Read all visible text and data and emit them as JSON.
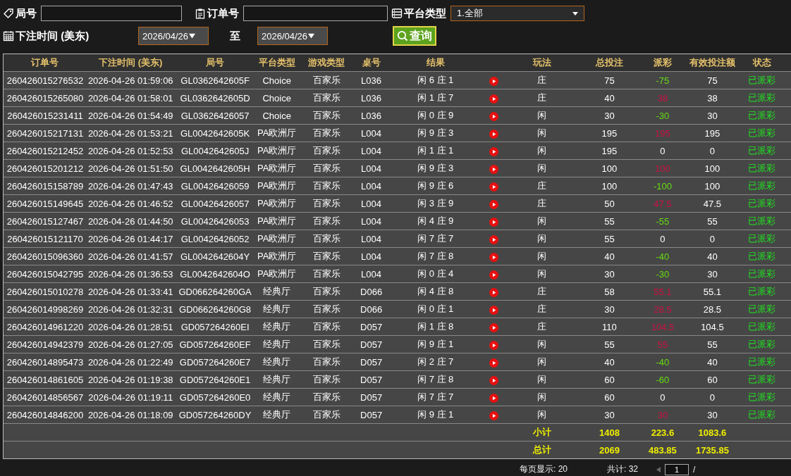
{
  "filters": {
    "round_label": "局号",
    "order_label": "订单号",
    "platform_label": "平台类型",
    "platform_value": "1.全部",
    "time_label": "下注时间 (美东)",
    "date_from": "2026/04/26",
    "to_label": "至",
    "date_to": "2026/04/26",
    "query_button": "查询"
  },
  "table": {
    "columns": [
      "订单号",
      "下注时间 (美东)",
      "局号",
      "平台类型",
      "游戏类型",
      "桌号",
      "结果",
      null,
      "玩法",
      "总投注",
      "派彩",
      "有效投注额",
      "状态"
    ],
    "rows": [
      {
        "order": "260426015276532",
        "time": "2026-04-26 01:59:06",
        "round": "GL0362642605F",
        "platform": "Choice",
        "game": "百家乐",
        "table": "L036",
        "result": "闲 6 庄 1",
        "bet": "庄",
        "total": "75",
        "payout": {
          "text": "-75",
          "color": "#66dd11"
        },
        "valid": "75",
        "status": "已派彩"
      },
      {
        "order": "260426015265080",
        "time": "2026-04-26 01:58:01",
        "round": "GL0362642605D",
        "platform": "Choice",
        "game": "百家乐",
        "table": "L036",
        "result": "闲 1 庄 7",
        "bet": "庄",
        "total": "40",
        "payout": {
          "text": "38",
          "color": "#cc1144"
        },
        "valid": "38",
        "status": "已派彩"
      },
      {
        "order": "260426015231411",
        "time": "2026-04-26 01:54:49",
        "round": "GL03626426057",
        "platform": "Choice",
        "game": "百家乐",
        "table": "L036",
        "result": "闲 0 庄 9",
        "bet": "闲",
        "total": "30",
        "payout": {
          "text": "-30",
          "color": "#66dd11"
        },
        "valid": "30",
        "status": "已派彩"
      },
      {
        "order": "260426015217131",
        "time": "2026-04-26 01:53:21",
        "round": "GL0042642605K",
        "platform": "PA欧洲厅",
        "game": "百家乐",
        "table": "L004",
        "result": "闲 9 庄 3",
        "bet": "闲",
        "total": "195",
        "payout": {
          "text": "195",
          "color": "#cc1144"
        },
        "valid": "195",
        "status": "已派彩"
      },
      {
        "order": "260426015212452",
        "time": "2026-04-26 01:52:53",
        "round": "GL0042642605J",
        "platform": "PA欧洲厅",
        "game": "百家乐",
        "table": "L004",
        "result": "闲 1 庄 1",
        "bet": "闲",
        "total": "195",
        "payout": {
          "text": "0",
          "color": "#ffffff"
        },
        "valid": "0",
        "status": "已派彩"
      },
      {
        "order": "260426015201212",
        "time": "2026-04-26 01:51:50",
        "round": "GL0042642605H",
        "platform": "PA欧洲厅",
        "game": "百家乐",
        "table": "L004",
        "result": "闲 9 庄 3",
        "bet": "闲",
        "total": "100",
        "payout": {
          "text": "100",
          "color": "#cc1144"
        },
        "valid": "100",
        "status": "已派彩"
      },
      {
        "order": "260426015158789",
        "time": "2026-04-26 01:47:43",
        "round": "GL00426426059",
        "platform": "PA欧洲厅",
        "game": "百家乐",
        "table": "L004",
        "result": "闲 9 庄 6",
        "bet": "庄",
        "total": "100",
        "payout": {
          "text": "-100",
          "color": "#66dd11"
        },
        "valid": "100",
        "status": "已派彩"
      },
      {
        "order": "260426015149645",
        "time": "2026-04-26 01:46:52",
        "round": "GL00426426057",
        "platform": "PA欧洲厅",
        "game": "百家乐",
        "table": "L004",
        "result": "闲 3 庄 9",
        "bet": "庄",
        "total": "50",
        "payout": {
          "text": "47.5",
          "color": "#cc1144"
        },
        "valid": "47.5",
        "status": "已派彩"
      },
      {
        "order": "260426015127467",
        "time": "2026-04-26 01:44:50",
        "round": "GL00426426053",
        "platform": "PA欧洲厅",
        "game": "百家乐",
        "table": "L004",
        "result": "闲 4 庄 9",
        "bet": "闲",
        "total": "55",
        "payout": {
          "text": "-55",
          "color": "#66dd11"
        },
        "valid": "55",
        "status": "已派彩"
      },
      {
        "order": "260426015121170",
        "time": "2026-04-26 01:44:17",
        "round": "GL00426426052",
        "platform": "PA欧洲厅",
        "game": "百家乐",
        "table": "L004",
        "result": "闲 7 庄 7",
        "bet": "闲",
        "total": "55",
        "payout": {
          "text": "0",
          "color": "#ffffff"
        },
        "valid": "0",
        "status": "已派彩"
      },
      {
        "order": "260426015096360",
        "time": "2026-04-26 01:41:57",
        "round": "GL0042642604Y",
        "platform": "PA欧洲厅",
        "game": "百家乐",
        "table": "L004",
        "result": "闲 7 庄 8",
        "bet": "闲",
        "total": "40",
        "payout": {
          "text": "-40",
          "color": "#66dd11"
        },
        "valid": "40",
        "status": "已派彩"
      },
      {
        "order": "260426015042795",
        "time": "2026-04-26 01:36:53",
        "round": "GL0042642604O",
        "platform": "PA欧洲厅",
        "game": "百家乐",
        "table": "L004",
        "result": "闲 0 庄 4",
        "bet": "闲",
        "total": "30",
        "payout": {
          "text": "-30",
          "color": "#66dd11"
        },
        "valid": "30",
        "status": "已派彩"
      },
      {
        "order": "260426015010278",
        "time": "2026-04-26 01:33:41",
        "round": "GD066264260GA",
        "platform": "经典厅",
        "game": "百家乐",
        "table": "D066",
        "result": "闲 4 庄 8",
        "bet": "庄",
        "total": "58",
        "payout": {
          "text": "55.1",
          "color": "#cc1144"
        },
        "valid": "55.1",
        "status": "已派彩"
      },
      {
        "order": "260426014998269",
        "time": "2026-04-26 01:32:31",
        "round": "GD066264260G8",
        "platform": "经典厅",
        "game": "百家乐",
        "table": "D066",
        "result": "闲 0 庄 1",
        "bet": "庄",
        "total": "30",
        "payout": {
          "text": "28.5",
          "color": "#cc1144"
        },
        "valid": "28.5",
        "status": "已派彩"
      },
      {
        "order": "260426014961220",
        "time": "2026-04-26 01:28:51",
        "round": "GD057264260EI",
        "platform": "经典厅",
        "game": "百家乐",
        "table": "D057",
        "result": "闲 1 庄 8",
        "bet": "庄",
        "total": "110",
        "payout": {
          "text": "104.5",
          "color": "#cc1144"
        },
        "valid": "104.5",
        "status": "已派彩"
      },
      {
        "order": "260426014942379",
        "time": "2026-04-26 01:27:05",
        "round": "GD057264260EF",
        "platform": "经典厅",
        "game": "百家乐",
        "table": "D057",
        "result": "闲 9 庄 1",
        "bet": "闲",
        "total": "55",
        "payout": {
          "text": "55",
          "color": "#cc1144"
        },
        "valid": "55",
        "status": "已派彩"
      },
      {
        "order": "260426014895473",
        "time": "2026-04-26 01:22:49",
        "round": "GD057264260E7",
        "platform": "经典厅",
        "game": "百家乐",
        "table": "D057",
        "result": "闲 2 庄 7",
        "bet": "闲",
        "total": "40",
        "payout": {
          "text": "-40",
          "color": "#66dd11"
        },
        "valid": "40",
        "status": "已派彩"
      },
      {
        "order": "260426014861605",
        "time": "2026-04-26 01:19:38",
        "round": "GD057264260E1",
        "platform": "经典厅",
        "game": "百家乐",
        "table": "D057",
        "result": "闲 7 庄 8",
        "bet": "闲",
        "total": "60",
        "payout": {
          "text": "-60",
          "color": "#66dd11"
        },
        "valid": "60",
        "status": "已派彩"
      },
      {
        "order": "260426014856567",
        "time": "2026-04-26 01:19:11",
        "round": "GD057264260E0",
        "platform": "经典厅",
        "game": "百家乐",
        "table": "D057",
        "result": "闲 7 庄 7",
        "bet": "闲",
        "total": "60",
        "payout": {
          "text": "0",
          "color": "#ffffff"
        },
        "valid": "0",
        "status": "已派彩"
      },
      {
        "order": "260426014846200",
        "time": "2026-04-26 01:18:09",
        "round": "GD057264260DY",
        "platform": "经典厅",
        "game": "百家乐",
        "table": "D057",
        "result": "闲 9 庄 1",
        "bet": "闲",
        "total": "30",
        "payout": {
          "text": "30",
          "color": "#cc1144"
        },
        "valid": "30",
        "status": "已派彩"
      }
    ],
    "summary": [
      {
        "label": "小计",
        "total": "1408",
        "payout": "223.6",
        "valid": "1083.6"
      },
      {
        "label": "总计",
        "total": "2069",
        "payout": "483.85",
        "valid": "1735.85"
      }
    ]
  },
  "pagination": {
    "per_page": "每页显示: 20",
    "count": "共计: 32",
    "page": "1",
    "separator": "/"
  }
}
